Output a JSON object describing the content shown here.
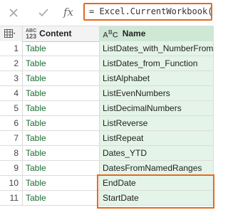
{
  "formula_bar": {
    "cancel_icon": "close-icon",
    "confirm_icon": "check-icon",
    "fx_label": "fx",
    "formula": "= Excel.CurrentWorkbook()",
    "highlight_color": "#e46a1f"
  },
  "header": {
    "table_menu_icon": "table-icon",
    "content_type_top": "ABC",
    "content_type_bottom": "123",
    "content_label": "Content",
    "name_type_icon": "text-type-icon",
    "name_label": "Name"
  },
  "rows": [
    {
      "num": "1",
      "content": "Table",
      "name": "ListDates_with_NumberFrom"
    },
    {
      "num": "2",
      "content": "Table",
      "name": "ListDates_from_Function"
    },
    {
      "num": "3",
      "content": "Table",
      "name": "ListAlphabet"
    },
    {
      "num": "4",
      "content": "Table",
      "name": "ListEvenNumbers"
    },
    {
      "num": "5",
      "content": "Table",
      "name": "ListDecimalNumbers"
    },
    {
      "num": "6",
      "content": "Table",
      "name": "ListReverse"
    },
    {
      "num": "7",
      "content": "Table",
      "name": "ListRepeat"
    },
    {
      "num": "8",
      "content": "Table",
      "name": "Dates_YTD"
    },
    {
      "num": "9",
      "content": "Table",
      "name": "DatesFromNamedRanges"
    },
    {
      "num": "10",
      "content": "Table",
      "name": "EndDate"
    },
    {
      "num": "11",
      "content": "Table",
      "name": "StartDate"
    }
  ],
  "colors": {
    "table_link": "#1a6e34",
    "name_column_bg": "#e4f4e8",
    "accent_outline": "#e46a1f"
  }
}
